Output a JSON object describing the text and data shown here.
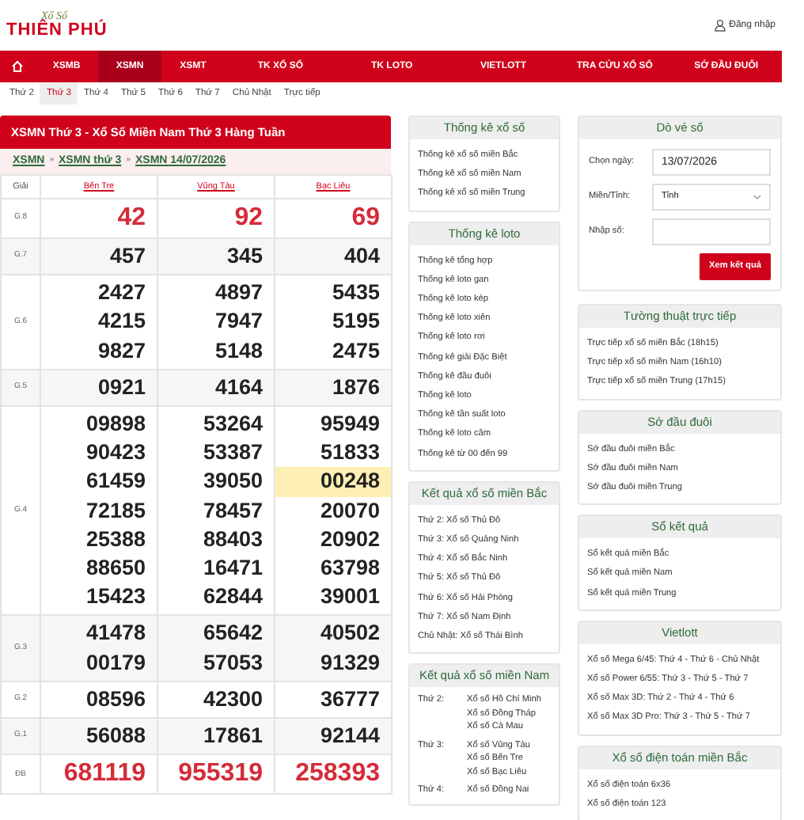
{
  "header": {
    "logo_top": "Xổ Số",
    "logo_main": "THIÊN PHÚ",
    "login": "Đăng nhập"
  },
  "nav": [
    {
      "label": "XSMB",
      "selected": false
    },
    {
      "label": "XSMN",
      "selected": true
    },
    {
      "label": "XSMT",
      "selected": false
    },
    {
      "label": "TK XỔ SỐ",
      "selected": false
    },
    {
      "label": "TK LOTO",
      "selected": false
    },
    {
      "label": "VIETLOTT",
      "selected": false
    },
    {
      "label": "TRA CỨU XỔ SỐ",
      "selected": false
    },
    {
      "label": "SỚ ĐẦU ĐUÔI",
      "selected": false
    }
  ],
  "subnav": [
    {
      "label": "Thứ 2",
      "selected": false
    },
    {
      "label": "Thứ 3",
      "selected": true
    },
    {
      "label": "Thứ 4",
      "selected": false
    },
    {
      "label": "Thứ 5",
      "selected": false
    },
    {
      "label": "Thứ 6",
      "selected": false
    },
    {
      "label": "Thứ 7",
      "selected": false
    },
    {
      "label": "Chủ Nhật",
      "selected": false
    },
    {
      "label": "Trực tiếp",
      "selected": false
    }
  ],
  "results": {
    "title": "XSMN Thứ 3 - Xổ Số Miền Nam Thứ 3 Hàng Tuần",
    "breadcrumb": [
      "XSMN",
      "XSMN thứ 3",
      "XSMN 14/07/2026"
    ],
    "separator": "»",
    "prize_header": "Giải",
    "columns": [
      "Bến Tre",
      "Vũng Tàu",
      "Bạc Liêu"
    ],
    "rows": [
      {
        "prize": "G.8",
        "emphasis": true,
        "cells": [
          [
            {
              "v": "42",
              "highlighted": false
            }
          ],
          [
            {
              "v": "92",
              "highlighted": false
            }
          ],
          [
            {
              "v": "69",
              "highlighted": false
            }
          ]
        ]
      },
      {
        "prize": "G.7",
        "emphasis": false,
        "cells": [
          [
            {
              "v": "457",
              "highlighted": false
            }
          ],
          [
            {
              "v": "345",
              "highlighted": false
            }
          ],
          [
            {
              "v": "404",
              "highlighted": false
            }
          ]
        ]
      },
      {
        "prize": "G.6",
        "emphasis": false,
        "cells": [
          [
            {
              "v": "2427",
              "highlighted": false
            },
            {
              "v": "4215",
              "highlighted": false
            },
            {
              "v": "9827",
              "highlighted": false
            }
          ],
          [
            {
              "v": "4897",
              "highlighted": false
            },
            {
              "v": "7947",
              "highlighted": false
            },
            {
              "v": "5148",
              "highlighted": false
            }
          ],
          [
            {
              "v": "5435",
              "highlighted": false
            },
            {
              "v": "5195",
              "highlighted": false
            },
            {
              "v": "2475",
              "highlighted": false
            }
          ]
        ]
      },
      {
        "prize": "G.5",
        "emphasis": false,
        "cells": [
          [
            {
              "v": "0921",
              "highlighted": false
            }
          ],
          [
            {
              "v": "4164",
              "highlighted": false
            }
          ],
          [
            {
              "v": "1876",
              "highlighted": false
            }
          ]
        ]
      },
      {
        "prize": "G.4",
        "emphasis": false,
        "cells": [
          [
            {
              "v": "09898",
              "highlighted": false
            },
            {
              "v": "90423",
              "highlighted": false
            },
            {
              "v": "61459",
              "highlighted": false
            },
            {
              "v": "72185",
              "highlighted": false
            },
            {
              "v": "25388",
              "highlighted": false
            },
            {
              "v": "88650",
              "highlighted": false
            },
            {
              "v": "15423",
              "highlighted": false
            }
          ],
          [
            {
              "v": "53264",
              "highlighted": false
            },
            {
              "v": "53387",
              "highlighted": false
            },
            {
              "v": "39050",
              "highlighted": false
            },
            {
              "v": "78457",
              "highlighted": false
            },
            {
              "v": "88403",
              "highlighted": false
            },
            {
              "v": "16471",
              "highlighted": false
            },
            {
              "v": "62844",
              "highlighted": false
            }
          ],
          [
            {
              "v": "95949",
              "highlighted": false
            },
            {
              "v": "51833",
              "highlighted": false
            },
            {
              "v": "00248",
              "highlighted": true
            },
            {
              "v": "20070",
              "highlighted": false
            },
            {
              "v": "20902",
              "highlighted": false
            },
            {
              "v": "63798",
              "highlighted": false
            },
            {
              "v": "39001",
              "highlighted": false
            }
          ]
        ]
      },
      {
        "prize": "G.3",
        "emphasis": false,
        "cells": [
          [
            {
              "v": "41478",
              "highlighted": false
            },
            {
              "v": "00179",
              "highlighted": false
            }
          ],
          [
            {
              "v": "65642",
              "highlighted": false
            },
            {
              "v": "57053",
              "highlighted": false
            }
          ],
          [
            {
              "v": "40502",
              "highlighted": false
            },
            {
              "v": "91329",
              "highlighted": false
            }
          ]
        ]
      },
      {
        "prize": "G.2",
        "emphasis": false,
        "cells": [
          [
            {
              "v": "08596",
              "highlighted": false
            }
          ],
          [
            {
              "v": "42300",
              "highlighted": false
            }
          ],
          [
            {
              "v": "36777",
              "highlighted": false
            }
          ]
        ]
      },
      {
        "prize": "G.1",
        "emphasis": false,
        "cells": [
          [
            {
              "v": "56088",
              "highlighted": false
            }
          ],
          [
            {
              "v": "17861",
              "highlighted": false
            }
          ],
          [
            {
              "v": "92144",
              "highlighted": false
            }
          ]
        ]
      },
      {
        "prize": "ĐB",
        "emphasis": true,
        "cells": [
          [
            {
              "v": "681119",
              "highlighted": false
            }
          ],
          [
            {
              "v": "955319",
              "highlighted": false
            }
          ],
          [
            {
              "v": "258393",
              "highlighted": false
            }
          ]
        ]
      }
    ]
  },
  "middle": [
    {
      "title": "Thống kê xổ số",
      "kind": "links",
      "items": [
        "Thống kê xổ số miền Bắc",
        "Thống kê xổ số miền Nam",
        "Thống kê xổ số miền Trung"
      ]
    },
    {
      "title": "Thống kê loto",
      "kind": "links",
      "items": [
        "Thống kê tổng hợp",
        "Thống kê loto gan",
        "Thống kê loto kép",
        "Thống kê loto xiên",
        "Thống kê loto rơi",
        "Thống kê giải Đặc Biệt",
        "Thống kê đầu đuôi",
        "Thống kê loto",
        "Thống kê tần suất loto",
        "Thống kê loto câm",
        "Thống kê từ 00 đến 99"
      ]
    },
    {
      "title": "Kết quả xổ số miền Bắc",
      "kind": "links",
      "items": [
        "Thứ 2: Xổ số Thủ Đô",
        "Thứ 3: Xổ số Quảng Ninh",
        "Thứ 4: Xổ số Bắc Ninh",
        "Thứ 5: Xổ số Thủ Đô",
        "Thứ 6: Xổ số Hải Phòng",
        "Thứ 7: Xổ số Nam Định",
        "Chủ Nhật: Xổ số Thái Bình"
      ]
    },
    {
      "title": "Kết quả xổ số miền Nam",
      "kind": "schedule",
      "rows": [
        {
          "day": "Thứ 2:",
          "items": [
            "Xổ số Hồ Chí Minh",
            "Xổ số Đồng Tháp",
            "Xổ số Cà Mau"
          ]
        },
        {
          "day": "Thứ 3:",
          "items": [
            "Xổ số Vũng Tàu",
            "Xổ số Bến Tre",
            "Xổ số Bạc Liêu"
          ]
        },
        {
          "day": "Thứ 4:",
          "items": [
            "Xổ số Đồng Nai"
          ]
        }
      ]
    }
  ],
  "ticket_check": {
    "title": "Dò vé số",
    "date_label": "Chọn ngày:",
    "date_value": "13/07/2026",
    "region_label": "Miền/Tỉnh:",
    "region_value": "Tỉnh",
    "number_label": "Nhập số:",
    "button": "Xem kết quả"
  },
  "right": [
    {
      "title": "Tường thuật trực tiếp",
      "items": [
        "Trực tiếp xổ số miền Bắc (18h15)",
        "Trực tiếp xổ số miền Nam (16h10)",
        "Trực tiếp xổ số miền Trung (17h15)"
      ]
    },
    {
      "title": "Sớ đầu đuôi",
      "items": [
        "Sớ đầu đuôi miền Bắc",
        "Sớ đầu đuôi miền Nam",
        "Sớ đầu đuôi miền Trung"
      ]
    },
    {
      "title": "Sổ kết quả",
      "items": [
        "Sổ kết quả miền Bắc",
        "Sổ kết quả miền Nam",
        "Sổ kết quả miền Trung"
      ]
    },
    {
      "title": "Vietlott",
      "items": [
        "Xổ số Mega 6/45: Thứ 4 - Thứ 6 - Chủ Nhật",
        "Xổ số Power 6/55: Thứ 3 - Thứ 5 - Thứ 7",
        "Xổ số Max 3D: Thứ 2 - Thứ 4 - Thứ 6",
        "Xổ số Max 3D Pro: Thứ 3 - Thứ 5 - Thứ 7"
      ]
    },
    {
      "title": "Xổ số điện toán miền Bắc",
      "items": [
        "Xổ số điện toán 6x36",
        "Xổ số điện toán 123"
      ]
    }
  ]
}
